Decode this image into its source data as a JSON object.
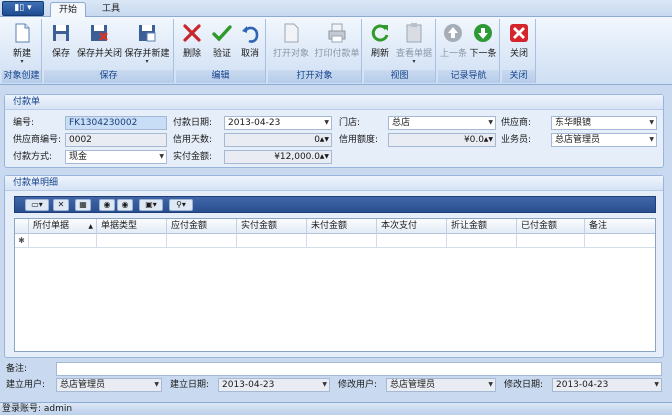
{
  "app_button": "▮▯ ▾",
  "tabs": [
    {
      "label": "开始"
    },
    {
      "label": "工具"
    }
  ],
  "ribbon": {
    "groups": {
      "create": "对象创建",
      "save": "保存",
      "edit": "编辑",
      "open": "打开对象",
      "view": "视图",
      "nav": "记录导航",
      "close": "关闭"
    },
    "buttons": {
      "new": "新建",
      "save": "保存",
      "save_close": "保存并关闭",
      "save_new": "保存并新建",
      "delete": "删除",
      "verify": "验证",
      "cancel": "取消",
      "open_object": "打开对象",
      "print_payment": "打印付款单",
      "refresh": "刷新",
      "view_bill": "查看单据",
      "prev": "上一条",
      "next": "下一条",
      "close": "关闭"
    }
  },
  "payment": {
    "section_title": "付款单",
    "no_label": "编号:",
    "no_value": "FK1304230002",
    "date_label": "付款日期:",
    "date_value": "2013-04-23",
    "store_label": "门店:",
    "store_value": "总店",
    "supplier_label": "供应商:",
    "supplier_value": "东华眼镜",
    "supplier_no_label": "供应商编号:",
    "supplier_no_value": "0002",
    "credit_days_label": "信用天数:",
    "credit_days_value": "0",
    "credit_limit_label": "信用额度:",
    "credit_limit_value": "¥0.0",
    "salesman_label": "业务员:",
    "salesman_value": "总店管理员",
    "method_label": "付款方式:",
    "method_value": "现金",
    "actual_label": "实付金额:",
    "actual_value": "¥12,000.0"
  },
  "detail": {
    "section_title": "付款单明细",
    "columns": [
      "所付单据",
      "单据类型",
      "应付金额",
      "实付金额",
      "未付金额",
      "本次支付",
      "折让金额",
      "已付金额",
      "备注"
    ],
    "new_row_marker": "✱",
    "sort_marker": "▲"
  },
  "footer": {
    "remark_label": "备注:",
    "remark_value": "",
    "creator_label": "建立用户:",
    "creator_value": "总店管理员",
    "created_label": "建立日期:",
    "created_value": "2013-04-23",
    "modifier_label": "修改用户:",
    "modifier_value": "总店管理员",
    "modified_label": "修改日期:",
    "modified_value": "2013-04-23"
  },
  "status": {
    "login": "登录账号: admin"
  },
  "colors": {
    "accent": "#15428b",
    "ribbon": "#dce8f7",
    "toolbar": "#2a4f90"
  }
}
